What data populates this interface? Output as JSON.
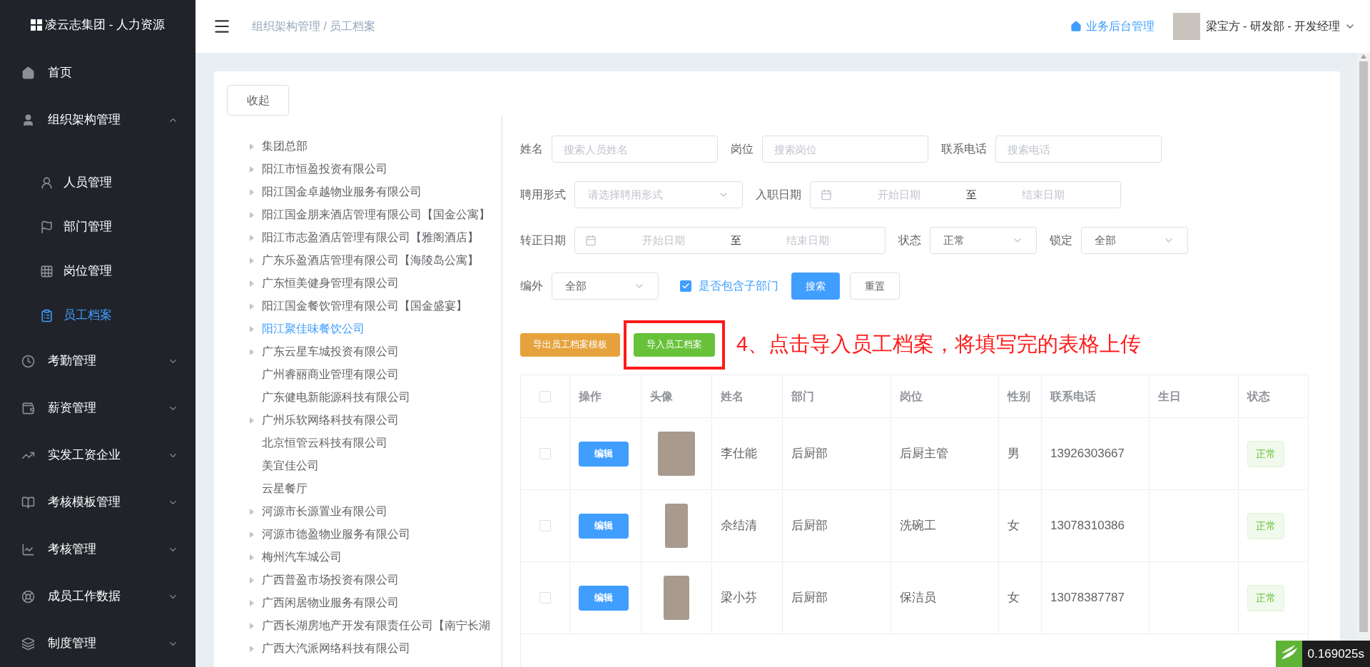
{
  "sidebar": {
    "logo": "凌云志集团 - 人力资源",
    "items": [
      {
        "kind": "item",
        "label": "首页",
        "selected": false
      },
      {
        "kind": "group",
        "label": "组织架构管理",
        "expanded": true,
        "children": [
          {
            "label": "人员管理",
            "selected": false
          },
          {
            "label": "部门管理",
            "selected": false
          },
          {
            "label": "岗位管理",
            "selected": false
          },
          {
            "label": "员工档案",
            "selected": true
          }
        ]
      },
      {
        "kind": "group",
        "label": "考勤管理",
        "expanded": false
      },
      {
        "kind": "group",
        "label": "薪资管理",
        "expanded": false
      },
      {
        "kind": "group",
        "label": "实发工资企业",
        "expanded": false
      },
      {
        "kind": "group",
        "label": "考核模板管理",
        "expanded": false
      },
      {
        "kind": "group",
        "label": "考核管理",
        "expanded": false
      },
      {
        "kind": "group",
        "label": "成员工作数据",
        "expanded": false
      },
      {
        "kind": "group",
        "label": "制度管理",
        "expanded": false
      }
    ]
  },
  "header": {
    "breadcrumb": "组织架构管理 / 员工档案",
    "admin_link": "业务后台管理",
    "user": "梁宝方 - 研发部 - 开发经理"
  },
  "collapse_button": "收起",
  "tree": [
    {
      "label": "集团总部",
      "has_children": true,
      "selected": false
    },
    {
      "label": "阳江市恒盈投资有限公司",
      "has_children": true,
      "selected": false
    },
    {
      "label": "阳江国金卓越物业服务有限公司",
      "has_children": true,
      "selected": false
    },
    {
      "label": "阳江国金朋来酒店管理有限公司【国金公寓】",
      "has_children": true,
      "selected": false
    },
    {
      "label": "阳江市志盈酒店管理有限公司【雅阁酒店】",
      "has_children": true,
      "selected": false
    },
    {
      "label": "广东乐盈酒店管理有限公司【海陵岛公寓】",
      "has_children": true,
      "selected": false
    },
    {
      "label": "广东恒美健身管理有限公司",
      "has_children": true,
      "selected": false
    },
    {
      "label": "阳江国金餐饮管理有限公司【国金盛宴】",
      "has_children": true,
      "selected": false
    },
    {
      "label": "阳江聚佳味餐饮公司",
      "has_children": true,
      "selected": true
    },
    {
      "label": "广东云星车城投资有限公司",
      "has_children": true,
      "selected": false
    },
    {
      "label": "广州睿丽商业管理有限公司",
      "has_children": false,
      "selected": false
    },
    {
      "label": "广东健电新能源科技有限公司",
      "has_children": false,
      "selected": false
    },
    {
      "label": "广州乐软网络科技有限公司",
      "has_children": true,
      "selected": false
    },
    {
      "label": "北京恒管云科技有限公司",
      "has_children": false,
      "selected": false
    },
    {
      "label": "美宜佳公司",
      "has_children": false,
      "selected": false
    },
    {
      "label": "云星餐厅",
      "has_children": false,
      "selected": false
    },
    {
      "label": "河源市长源置业有限公司",
      "has_children": true,
      "selected": false
    },
    {
      "label": "河源市德盈物业服务有限公司",
      "has_children": true,
      "selected": false
    },
    {
      "label": "梅州汽车城公司",
      "has_children": true,
      "selected": false
    },
    {
      "label": "广西普盈市场投资有限公司",
      "has_children": true,
      "selected": false
    },
    {
      "label": "广西闲居物业服务有限公司",
      "has_children": true,
      "selected": false
    },
    {
      "label": "广西长湖房地产开发有限责任公司【南宁长湖",
      "has_children": true,
      "selected": false
    },
    {
      "label": "广西大汽派网络科技有限公司",
      "has_children": true,
      "selected": false
    }
  ],
  "filters": [
    [
      {
        "kind": "text",
        "label": "姓名",
        "placeholder": "搜索人员姓名"
      },
      {
        "kind": "text",
        "label": "岗位",
        "placeholder": "搜索岗位"
      },
      {
        "kind": "text",
        "label": "联系电话",
        "placeholder": "搜索电话"
      }
    ],
    [
      {
        "kind": "select",
        "label": "聘用形式",
        "placeholder": "请选择聘用形式"
      },
      {
        "kind": "daterange",
        "label": "入职日期",
        "start": "开始日期",
        "separator": "至",
        "end": "结束日期"
      }
    ],
    [
      {
        "kind": "daterange",
        "label": "转正日期",
        "start": "开始日期",
        "separator": "至",
        "end": "结束日期"
      },
      {
        "kind": "select",
        "label": "状态",
        "value": "正常"
      },
      {
        "kind": "select",
        "label": "锁定",
        "value": "全部"
      }
    ],
    [
      {
        "kind": "select",
        "label": "编外",
        "value": "全部"
      },
      {
        "kind": "checkbox",
        "label": "是否包含子部门",
        "checked": true
      },
      {
        "kind": "button",
        "label": "搜索",
        "primary": true
      },
      {
        "kind": "button",
        "label": "重置",
        "primary": false
      }
    ]
  ],
  "actions": [
    {
      "label": "导出员工档案模板",
      "kind": "warning",
      "highlighted": false
    },
    {
      "label": "导入员工档案",
      "kind": "success",
      "highlighted": true
    }
  ],
  "annotation": "4、点击导入员工档案，将填写完的表格上传",
  "table": {
    "all_checked": false,
    "columns": [
      "操作",
      "头像",
      "姓名",
      "部门",
      "岗位",
      "性别",
      "联系电话",
      "生日",
      "状态"
    ],
    "rows": [
      {
        "checked": false,
        "action": "编辑",
        "name": "李仕能",
        "department": "后厨部",
        "position": "后厨主管",
        "gender": "男",
        "phone": "13926303667",
        "status": "正常"
      },
      {
        "checked": false,
        "action": "编辑",
        "name": "佘结清",
        "department": "后厨部",
        "position": "洗碗工",
        "gender": "女",
        "phone": "13078310386",
        "status": "正常"
      },
      {
        "checked": false,
        "action": "编辑",
        "name": "梁小芬",
        "department": "后厨部",
        "position": "保洁员",
        "gender": "女",
        "phone": "13078387787",
        "status": "正常"
      }
    ]
  },
  "timing_badge": "0.169025s"
}
